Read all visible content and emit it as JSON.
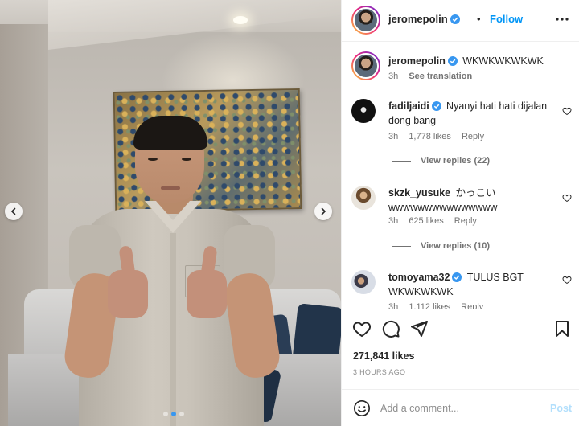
{
  "post": {
    "username": "jeromepolin",
    "follow_label": "Follow",
    "separator": "•",
    "caption": "WKWKWKWKWK",
    "caption_time": "3h",
    "see_translation": "See translation",
    "likes": "271,841 likes",
    "posted_ago": "3 HOURS AGO"
  },
  "media": {
    "dots": 3,
    "active_dot": 1
  },
  "comments": [
    {
      "username": "fadiljaidi",
      "verified": true,
      "text_line1": "Nyanyi hati hati dijalan",
      "text_line2": "dong bang",
      "time": "3h",
      "likes": "1,778 likes",
      "reply": "Reply",
      "view_replies": "View replies (22)"
    },
    {
      "username": "skzk_yusuke",
      "verified": false,
      "text_line1": "かっこい",
      "text_line2": "wwwwwwwwwwwwwww",
      "time": "3h",
      "likes": "625 likes",
      "reply": "Reply",
      "view_replies": "View replies (10)"
    },
    {
      "username": "tomoyama32",
      "verified": true,
      "text_line1": "TULUS BGT",
      "text_line2": "WKWKWKWK",
      "time": "3h",
      "likes": "1,112 likes",
      "reply": "Reply"
    }
  ],
  "add_comment": {
    "placeholder": "Add a comment...",
    "post_label": "Post"
  },
  "icons": {
    "verified": "verified-badge-icon",
    "heart": "heart-icon",
    "comment": "comment-icon",
    "share": "send-icon",
    "save": "bookmark-icon",
    "emoji": "emoji-icon",
    "more": "more-options-icon",
    "prev": "chevron-left-icon",
    "next": "chevron-right-icon"
  },
  "colors": {
    "accent": "#0095f6",
    "verified": "#3897f0",
    "muted": "#737373",
    "post_disabled": "#b2dffc"
  }
}
